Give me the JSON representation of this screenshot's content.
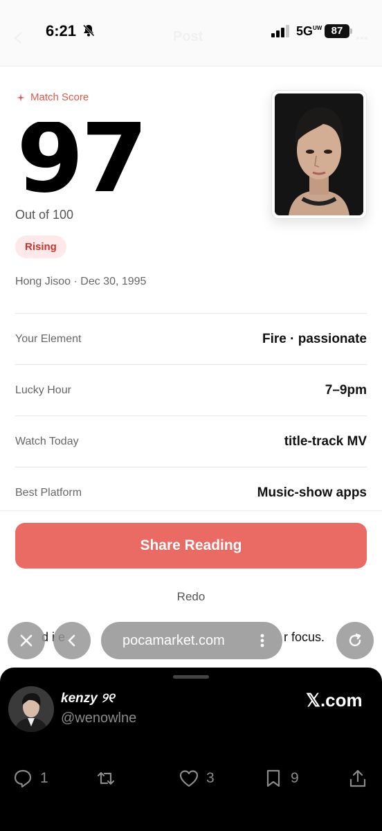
{
  "status_bar": {
    "time": "6:21",
    "network": "5G",
    "network_suffix": "UW",
    "battery": "87",
    "faded_title": "Post"
  },
  "match": {
    "label": "Match Score",
    "score": "97",
    "out_of": "Out of 100",
    "badge": "Rising",
    "subject": "Hong Jisoo · Dec 30, 1995"
  },
  "info_rows": [
    {
      "label": "Your Element",
      "value": "Fire · passionate"
    },
    {
      "label": "Lucky Hour",
      "value": "7–9pm"
    },
    {
      "label": "Watch Today",
      "value": "title-track MV"
    },
    {
      "label": "Best Platform",
      "value": "Music-show apps"
    }
  ],
  "actions": {
    "share": "Share Reading",
    "redo": "Redo"
  },
  "partial_text": {
    "head": "d i   e",
    "tail": "r focus."
  },
  "browser": {
    "url": "pocamarket.com"
  },
  "x_post": {
    "display_name": "kenzy ୨୧",
    "handle": "@wenowlne",
    "site": "𝕏.com",
    "replies": "1",
    "likes": "3",
    "bookmarks": "9"
  },
  "colors": {
    "accent": "#ea6a64",
    "badge_bg": "#fde9e9",
    "badge_text": "#c9332b"
  }
}
